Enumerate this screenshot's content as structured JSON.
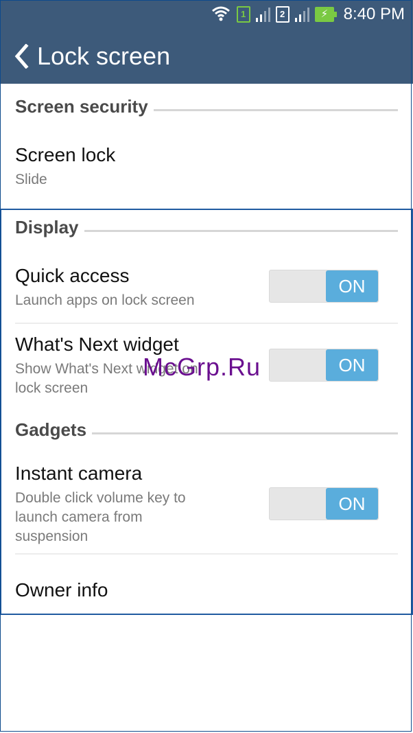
{
  "status": {
    "time": "8:40 PM",
    "sim1_label": "1",
    "sim2_label": "2",
    "icons": [
      "wifi-icon",
      "sim1-icon",
      "signal-icon",
      "sim2-icon",
      "signal-icon",
      "battery-charging-icon"
    ]
  },
  "appbar": {
    "title": "Lock screen",
    "back_icon": "chevron-left-icon",
    "background": "#3d5a7a"
  },
  "sections": {
    "security": "Screen security",
    "display": "Display",
    "gadgets": "Gadgets"
  },
  "items": {
    "screen_lock": {
      "title": "Screen lock",
      "subtitle": "Slide"
    },
    "quick_access": {
      "title": "Quick access",
      "subtitle": "Launch apps on lock screen",
      "toggle": "ON"
    },
    "whats_next": {
      "title": "What's Next widget",
      "subtitle_line1": "Show What's Next widget on",
      "subtitle_line2": "lock screen",
      "toggle": "ON"
    },
    "instant_camera": {
      "title": "Instant camera",
      "subtitle_line1": "Double click volume key to",
      "subtitle_line2": "launch camera from",
      "subtitle_line3": "suspension",
      "toggle": "ON"
    },
    "owner_info": {
      "title": "Owner info"
    }
  },
  "watermark": "McGrp.Ru",
  "colors": {
    "toggle_on": "#5aaddc",
    "highlight_border": "#1f5aa0"
  }
}
